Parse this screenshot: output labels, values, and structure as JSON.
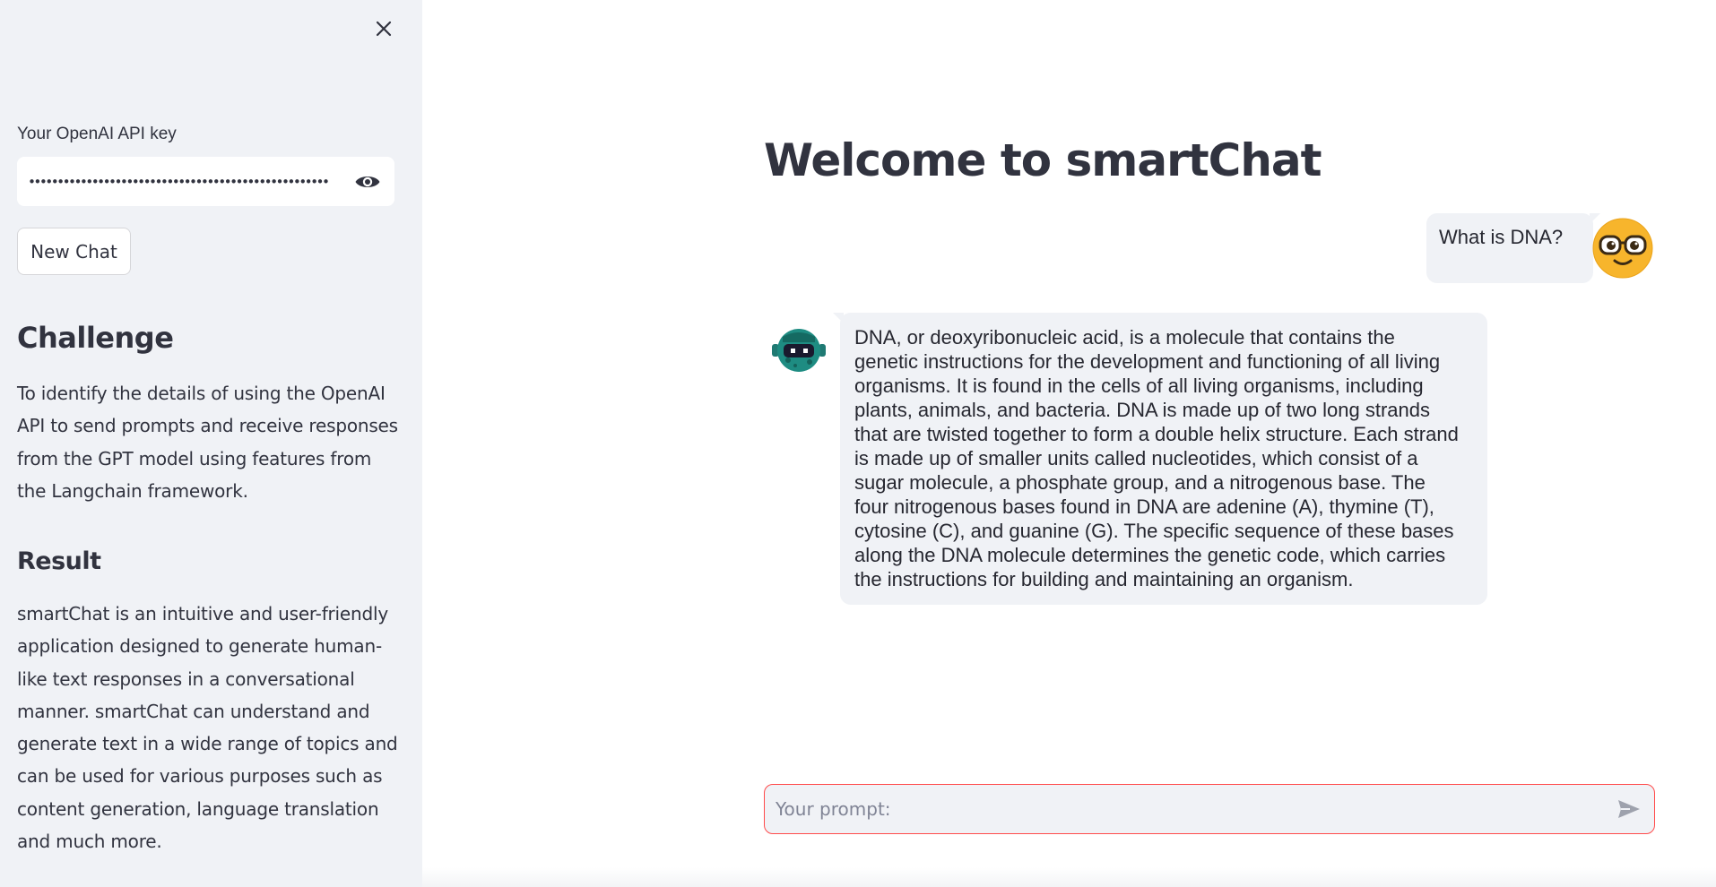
{
  "sidebar": {
    "close_icon": "close-icon",
    "api_key_label": "Your OpenAI API key",
    "api_key_value": "••••••••••••••••••••••••••••••••••••••••••••••••••••",
    "visibility_icon": "eye-icon",
    "new_chat_label": "New Chat",
    "challenge_heading": "Challenge",
    "challenge_text": "To identify the details of using the OpenAI API to send prompts and receive responses from the GPT model using features from the Langchain framework.",
    "result_heading": "Result",
    "result_text": "smartChat is an intuitive and user-friendly application designed to generate human-like text responses in a conversational manner. smartChat can understand and generate text in a wide range of topics and can be used for various purposes such as content generation, language translation and much more."
  },
  "main": {
    "title": "Welcome to smartChat",
    "messages": [
      {
        "role": "user",
        "avatar_icon": "nerd-face-icon",
        "text": "What is DNA?"
      },
      {
        "role": "assistant",
        "avatar_icon": "robot-avatar-icon",
        "text": "DNA, or deoxyribonucleic acid, is a molecule that contains the\ngenetic instructions for the development and functioning of all living\norganisms. It is found in the cells of all living organisms, including\nplants, animals, and bacteria. DNA is made up of two long strands\nthat are twisted together to form a double helix structure. Each strand\nis made up of smaller units called nucleotides, which consist of a\nsugar molecule, a phosphate group, and a nitrogenous base. The\nfour nitrogenous bases found in DNA are adenine (A), thymine (T),\ncytosine (C), and guanine (G). The specific sequence of these bases\nalong the DNA molecule determines the genetic code, which carries\nthe instructions for building and maintaining an organism."
      }
    ],
    "prompt_placeholder": "Your prompt:",
    "send_icon": "send-icon"
  },
  "colors": {
    "sidebar_bg": "#f0f2f6",
    "text": "#31333f",
    "accent_red": "#ff4b4b",
    "bubble_bg": "#f0f2f6"
  }
}
